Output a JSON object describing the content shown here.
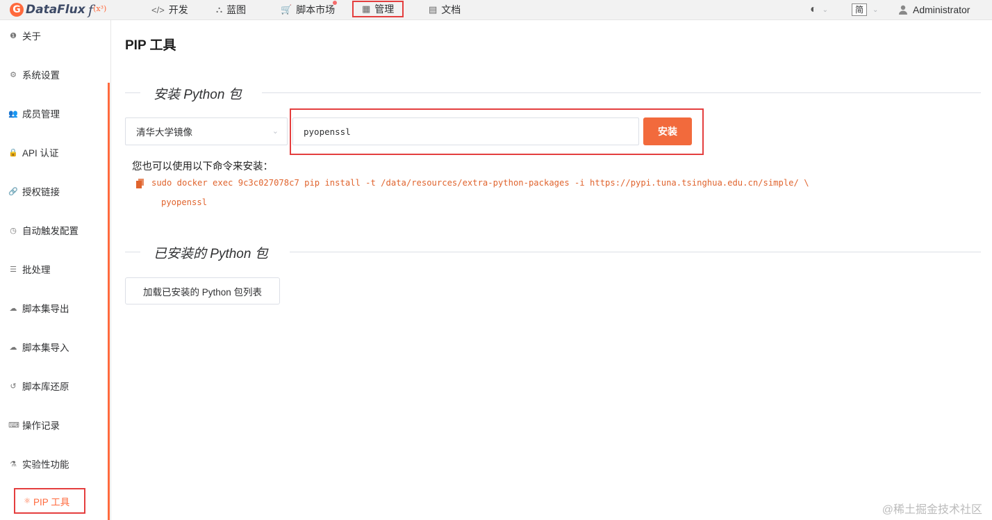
{
  "brand": {
    "logo_letter": "G",
    "name": "DataFlux",
    "func": "f",
    "func_sup": "(x³)"
  },
  "topnav": [
    {
      "icon": "</>",
      "label": "开发"
    },
    {
      "icon": "⛬",
      "label": "蓝图"
    },
    {
      "icon": "🛒",
      "label": "脚本市场"
    },
    {
      "icon": "▦",
      "label": "管理"
    },
    {
      "icon": "▤",
      "label": "文档"
    }
  ],
  "top_right": {
    "theme_icon": "◐",
    "lang": "简",
    "user": "Administrator",
    "chevron": "⌄"
  },
  "sidebar": [
    {
      "icon": "❶",
      "label": "关于"
    },
    {
      "icon": "⚙",
      "label": "系统设置"
    },
    {
      "icon": "👥",
      "label": "成员管理"
    },
    {
      "icon": "🔒",
      "label": "API 认证"
    },
    {
      "icon": "🔗",
      "label": "授权链接"
    },
    {
      "icon": "◷",
      "label": "自动触发配置"
    },
    {
      "icon": "☰",
      "label": "批处理"
    },
    {
      "icon": "☁",
      "label": "脚本集导出"
    },
    {
      "icon": "☁",
      "label": "脚本集导入"
    },
    {
      "icon": "↺",
      "label": "脚本库还原"
    },
    {
      "icon": "⌨",
      "label": "操作记录"
    },
    {
      "icon": "⚗",
      "label": "实验性功能"
    },
    {
      "icon": "⚛",
      "label": "PIP 工具"
    }
  ],
  "page": {
    "title": "PIP 工具",
    "install_section": "安装 Python 包",
    "mirror_selected": "清华大学镜像",
    "package_value": "pyopenssl",
    "install_button": "安装",
    "hint": "您也可以使用以下命令来安装：",
    "command_line1": "sudo docker exec 9c3c027078c7 pip install -t /data/resources/extra-python-packages -i https://pypi.tuna.tsinghua.edu.cn/simple/ \\",
    "command_line2": "pyopenssl",
    "installed_section": "已安装的 Python 包",
    "load_button": "加载已安装的 Python 包列表"
  },
  "watermark": "@稀土掘金技术社区",
  "colors": {
    "accent": "#f26a3c",
    "highlight_border": "#e43e3e",
    "command": "#e0642e"
  }
}
